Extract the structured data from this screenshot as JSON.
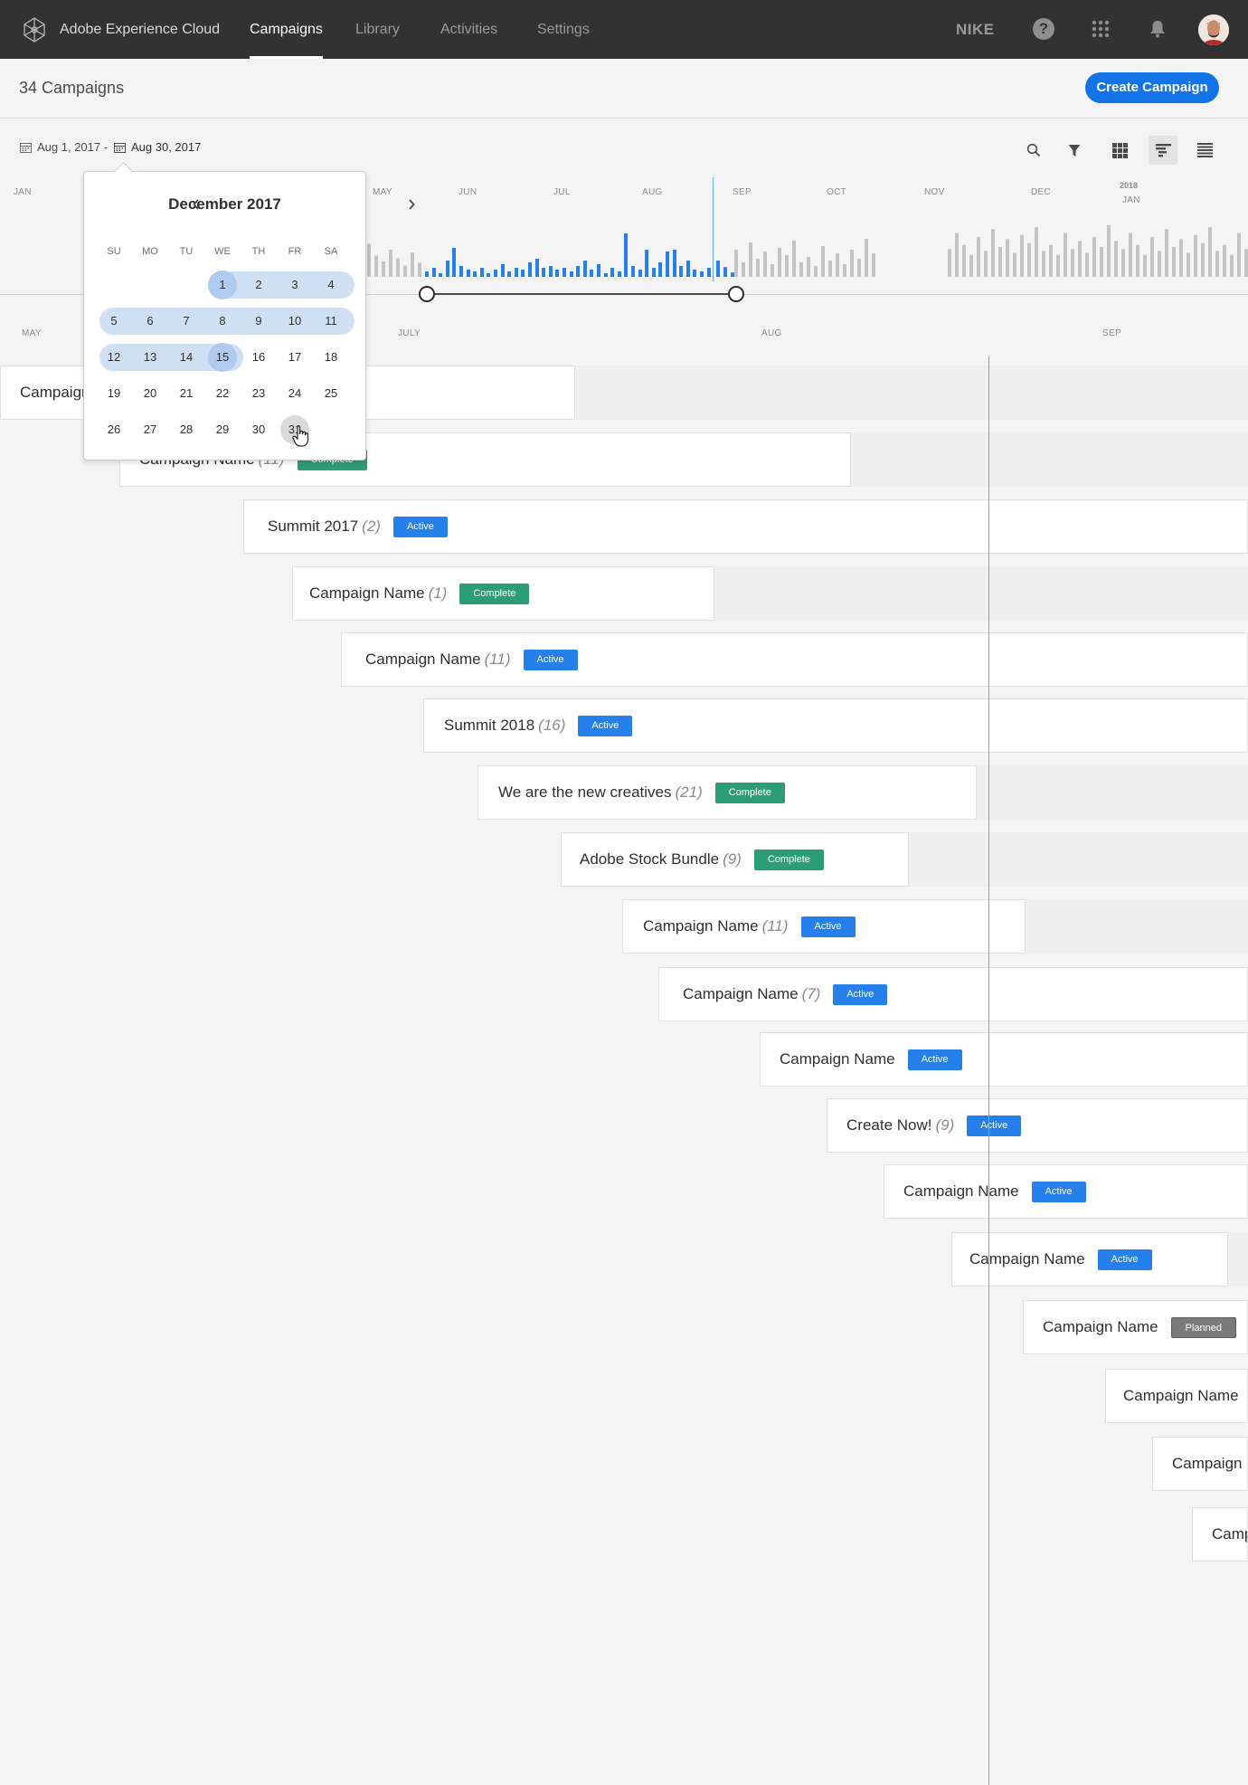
{
  "nav": {
    "brand": "Adobe Experience Cloud",
    "tabs": [
      "Campaigns",
      "Library",
      "Activities",
      "Settings"
    ],
    "active_tab": "Campaigns",
    "org": "NIKE",
    "icons": [
      "help-icon",
      "apps-grid-icon",
      "bell-icon",
      "avatar"
    ]
  },
  "header": {
    "title": "34 Campaigns",
    "create_label": "Create Campaign"
  },
  "toolbar": {
    "start_date": "Aug 1, 2017 -",
    "end_date": "Aug 30, 2017",
    "icons": [
      "search-icon",
      "filter-icon",
      "grid-view-icon",
      "timeline-view-icon",
      "list-view-icon"
    ],
    "active_view": "timeline-view-icon"
  },
  "overview": {
    "months": [
      "JAN",
      "MAY",
      "JUN",
      "JUL",
      "AUG",
      "SEP",
      "OCT",
      "NOV",
      "DEC",
      "JAN"
    ],
    "year_label": "2018"
  },
  "timeline": {
    "months": [
      "MAY",
      "JULY",
      "AUG",
      "SEP"
    ]
  },
  "calendar": {
    "title": "December 2017",
    "prev": "‹",
    "next": "›",
    "weekdays": [
      "SU",
      "MO",
      "TU",
      "WE",
      "TH",
      "FR",
      "SA"
    ],
    "days": [
      "1",
      "2",
      "3",
      "4",
      "5",
      "6",
      "7",
      "8",
      "9",
      "10",
      "11",
      "12",
      "13",
      "14",
      "15",
      "16",
      "17",
      "18",
      "19",
      "20",
      "21",
      "22",
      "23",
      "24",
      "25",
      "26",
      "27",
      "28",
      "29",
      "30",
      "31"
    ],
    "range_start": "1",
    "range_end": "15",
    "hovered_day": "31"
  },
  "campaigns": [
    {
      "name": "Campaign Name",
      "count": "",
      "status": ""
    },
    {
      "name": "Campaign Name",
      "count": "(11)",
      "status": "Complete"
    },
    {
      "name": "Summit 2017",
      "count": "(2)",
      "status": "Active"
    },
    {
      "name": "Campaign Name",
      "count": "(1)",
      "status": "Complete"
    },
    {
      "name": "Campaign Name",
      "count": "(11)",
      "status": "Active"
    },
    {
      "name": "Summit 2018",
      "count": "(16)",
      "status": "Active"
    },
    {
      "name": "We are the new creatives",
      "count": "(21)",
      "status": "Complete"
    },
    {
      "name": "Adobe Stock Bundle",
      "count": "(9)",
      "status": "Complete"
    },
    {
      "name": "Campaign Name",
      "count": "(11)",
      "status": "Active"
    },
    {
      "name": "Campaign Name",
      "count": "(7)",
      "status": "Active"
    },
    {
      "name": "Campaign Name",
      "count": "",
      "status": "Active"
    },
    {
      "name": "Create Now!",
      "count": "(9)",
      "status": "Active"
    },
    {
      "name": "Campaign Name",
      "count": "",
      "status": "Active"
    },
    {
      "name": "Campaign Name",
      "count": "",
      "status": "Active"
    },
    {
      "name": "Campaign Name",
      "count": "",
      "status": "Planned"
    },
    {
      "name": "Campaign Name",
      "count": "",
      "status": ""
    },
    {
      "name": "Campaign Name",
      "count": "",
      "status": ""
    },
    {
      "name": "Campaign Name",
      "count": "",
      "status": ""
    }
  ]
}
